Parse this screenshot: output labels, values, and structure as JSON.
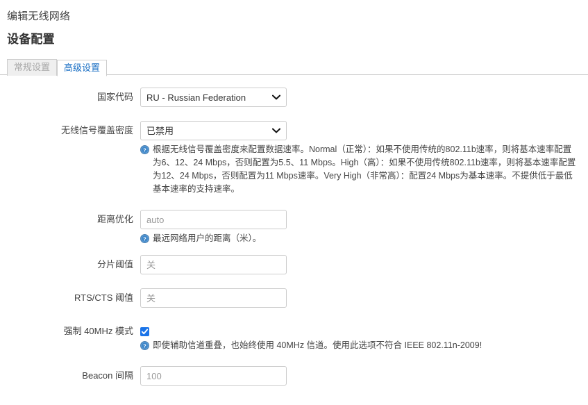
{
  "header": {
    "page_title": "编辑无线网络",
    "section_title": "设备配置"
  },
  "tabs": [
    {
      "label": "常规设置",
      "active": false
    },
    {
      "label": "高级设置",
      "active": true
    }
  ],
  "form": {
    "country_code": {
      "label": "国家代码",
      "value": "RU - Russian Federation",
      "options": [
        "RU - Russian Federation"
      ]
    },
    "coverage_density": {
      "label": "无线信号覆盖密度",
      "value": "已禁用",
      "options": [
        "已禁用"
      ],
      "help": "根据无线信号覆盖密度来配置数据速率。Normal（正常）：如果不使用传统的802.11b速率，则将基本速率配置为6、12、24 Mbps，否则配置为5.5、11 Mbps。High（高）：如果不使用传统802.11b速率，则将基本速率配置为12、24 Mbps，否则配置为11 Mbps速率。Very High（非常高）：配置24 Mbps为基本速率。不提供低于最低基本速率的支持速率。"
    },
    "distance_optimization": {
      "label": "距离优化",
      "value": "",
      "placeholder": "auto",
      "help": "最远网络用户的距离（米）。"
    },
    "fragmentation_threshold": {
      "label": "分片阈值",
      "value": "",
      "placeholder": "关"
    },
    "rts_cts_threshold": {
      "label": "RTS/CTS 阈值",
      "value": "",
      "placeholder": "关"
    },
    "force_40mhz": {
      "label": "强制 40MHz 模式",
      "checked": true,
      "help": "即使辅助信道重叠，也始终使用 40MHz 信道。使用此选项不符合 IEEE 802.11n-2009!"
    },
    "beacon_interval": {
      "label": "Beacon 间隔",
      "value": "",
      "placeholder": "100"
    }
  },
  "icons": {
    "help": "help-question-icon",
    "chevron": "chevron-down-icon",
    "check": "checkmark-icon"
  },
  "colors": {
    "accent": "#1a6fc4",
    "checkbox": "#1a73e8",
    "border": "#cccccc",
    "tab_inactive_bg": "#efefef",
    "text": "#404040"
  }
}
